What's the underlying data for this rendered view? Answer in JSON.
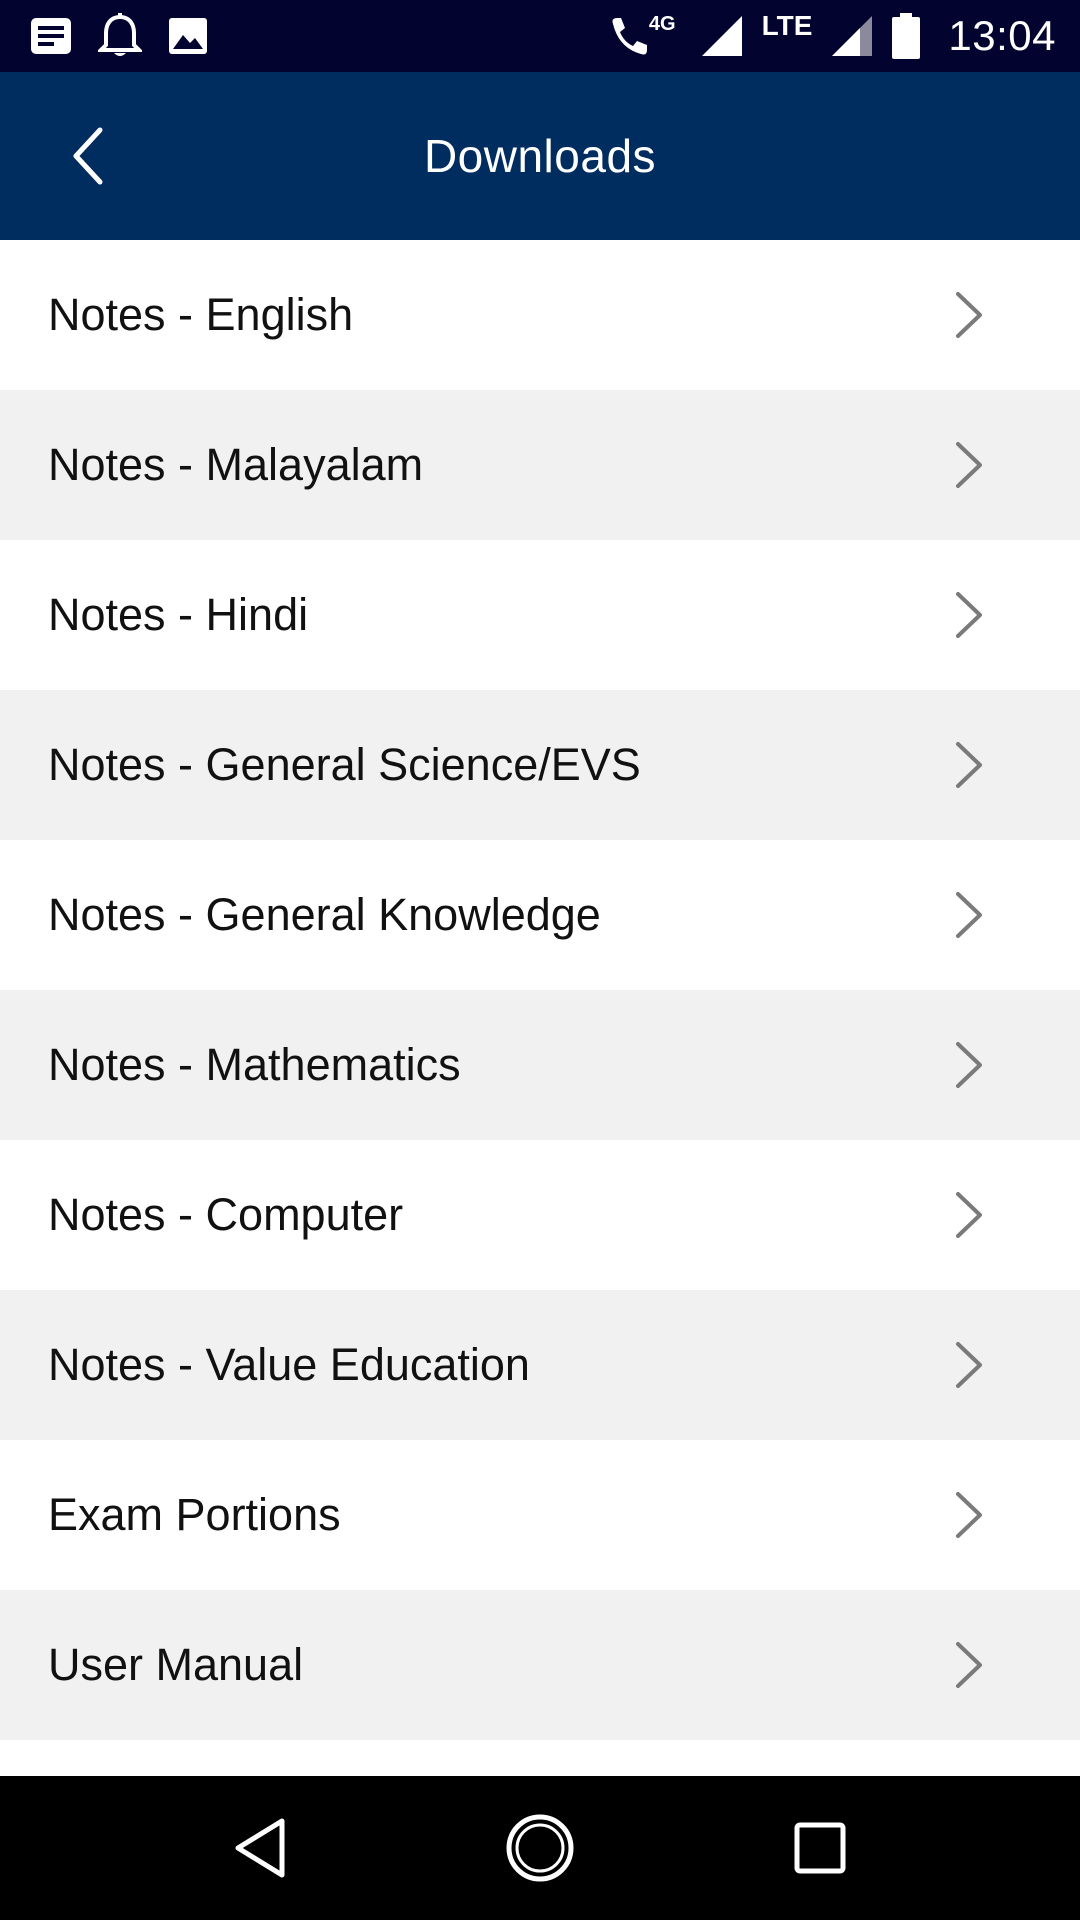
{
  "status_bar": {
    "network_label": "4G",
    "lte_label": "LTE",
    "time": "13:04",
    "icons": [
      "notes-icon",
      "bell-icon",
      "image-icon",
      "wifi-call-icon",
      "signal-icon",
      "signal-icon",
      "battery-icon"
    ]
  },
  "app_bar": {
    "title": "Downloads",
    "back_icon": "chevron-left-icon"
  },
  "list": {
    "items": [
      {
        "label": "Notes - English"
      },
      {
        "label": "Notes - Malayalam"
      },
      {
        "label": "Notes - Hindi"
      },
      {
        "label": "Notes - General Science/EVS"
      },
      {
        "label": "Notes - General Knowledge"
      },
      {
        "label": "Notes - Mathematics"
      },
      {
        "label": "Notes - Computer"
      },
      {
        "label": "Notes - Value Education"
      },
      {
        "label": "Exam Portions"
      },
      {
        "label": "User Manual"
      }
    ],
    "chevron_icon": "chevron-right-icon"
  },
  "colors": {
    "status_bar_bg": "#03032f",
    "app_bar_bg": "#002d5f",
    "row_alt_bg": "#f2f1f2",
    "nav_bar_bg": "#000000"
  }
}
